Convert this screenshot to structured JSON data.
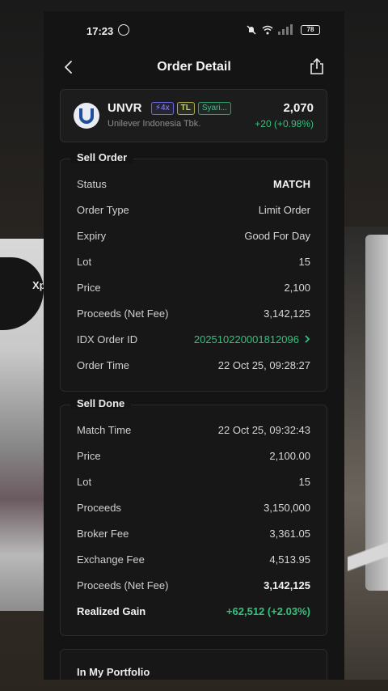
{
  "status_bar": {
    "time": "17:23",
    "battery": "78"
  },
  "header": {
    "title": "Order Detail"
  },
  "stock": {
    "code": "UNVR",
    "badge_margin": "4x",
    "badge_tl": "TL",
    "badge_syariah": "Syari...",
    "name": "Unilever Indonesia Tbk.",
    "price": "2,070",
    "change": "+20 (+0.98%)",
    "colors": {
      "up": "#35c07c",
      "logo": "#1f4e9c"
    }
  },
  "sell_order": {
    "title": "Sell Order",
    "rows": [
      {
        "label": "Status",
        "value": "MATCH"
      },
      {
        "label": "Order Type",
        "value": "Limit Order"
      },
      {
        "label": "Expiry",
        "value": "Good For Day"
      },
      {
        "label": "Lot",
        "value": "15"
      },
      {
        "label": "Price",
        "value": "2,100"
      },
      {
        "label": "Proceeds (Net Fee)",
        "value": "3,142,125"
      },
      {
        "label": "IDX Order ID",
        "value": "202510220001812096"
      },
      {
        "label": "Order Time",
        "value": "22 Oct 25, 09:28:27"
      }
    ]
  },
  "sell_done": {
    "title": "Sell Done",
    "rows": [
      {
        "label": "Match Time",
        "value": "22 Oct 25, 09:32:43"
      },
      {
        "label": "Price",
        "value": "2,100.00"
      },
      {
        "label": "Lot",
        "value": "15"
      },
      {
        "label": "Proceeds",
        "value": "3,150,000"
      },
      {
        "label": "Broker Fee",
        "value": "3,361.05"
      },
      {
        "label": "Exchange Fee",
        "value": "4,513.95"
      },
      {
        "label": "Proceeds (Net Fee)",
        "value": "3,142,125"
      },
      {
        "label": "Realized Gain",
        "value": "+62,512 (+2.03%)"
      }
    ]
  },
  "portfolio": {
    "title": "In My Portfolio"
  },
  "background": {
    "left_text": "Xp"
  }
}
